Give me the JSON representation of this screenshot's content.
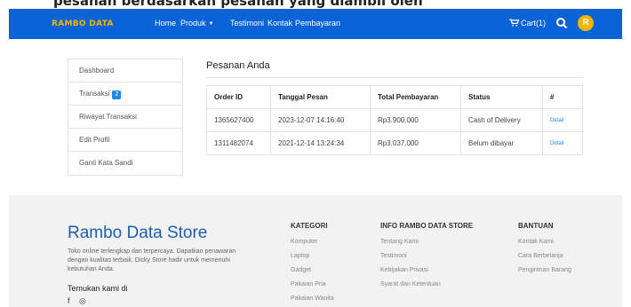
{
  "top_caption": "pesanan berdasarkan pesanan yang diambil oleh",
  "navbar": {
    "brand": "RAMBO DATA",
    "links": [
      "Home",
      "Produk",
      "Testimoni",
      "Kontak",
      "Pembayaran"
    ],
    "cart_label": "Cart(1)",
    "avatar_initial": "R",
    "accent": "#0b63d8"
  },
  "sidebar": {
    "items": [
      {
        "label": "Dashboard"
      },
      {
        "label": "Transaksi",
        "badge": "2"
      },
      {
        "label": "Riwayat Transaksi"
      },
      {
        "label": "Edit Profil"
      },
      {
        "label": "Ganti Kata Sandi"
      }
    ]
  },
  "main": {
    "title": "Pesanan Anda",
    "columns": [
      "Order ID",
      "Tanggal Pesan",
      "Total Pembayaran",
      "Status",
      "#"
    ],
    "rows": [
      {
        "order_id": "1365627400",
        "date": "2023-12-07 14:16:40",
        "total": "Rp3.900.000",
        "status": "Cash of Delivery",
        "action": "Detail"
      },
      {
        "order_id": "1311482074",
        "date": "2021-12-14 13:24:34",
        "total": "Rp3.037.000",
        "status": "Belum dibayar",
        "action": "Detail"
      }
    ]
  },
  "footer": {
    "store_name": "Rambo Data Store",
    "description": "Toko online terlengkap dan terpercaya. Dapatkan penawaran dengan kualitas terbaik. Dicky Store hadir untuk memenuhi kebutuhan Anda.",
    "find_us": "Temukan kami di",
    "social_icons": [
      "facebook-icon",
      "instagram-icon"
    ],
    "kategori": {
      "heading": "KATEGORI",
      "items": [
        "Komputer",
        "Laptop",
        "Gadget",
        "Pakaian Pria",
        "Pakaian Wanita"
      ]
    },
    "info": {
      "heading": "INFO RAMBO DATA STORE",
      "items": [
        "Tentang Kami",
        "Testimoni",
        "Kebijakan Privasi",
        "Syarat dan Ketentuan"
      ]
    },
    "bantuan": {
      "heading": "BANTUAN",
      "items": [
        "Kontak Kami",
        "Cara Berbelanja",
        "Pengiriman Barang"
      ]
    }
  }
}
